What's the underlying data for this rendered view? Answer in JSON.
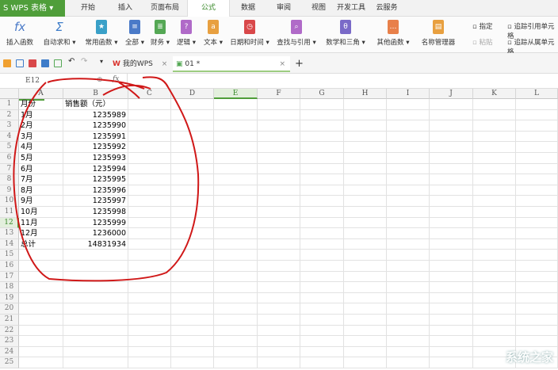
{
  "app": {
    "logo": "WPS 表格",
    "logo_icon": "S",
    "dropdown": "▾"
  },
  "menu_tabs": [
    "开始",
    "插入",
    "页面布局",
    "公式",
    "数据",
    "审阅",
    "视图",
    "开发工具",
    "云服务"
  ],
  "active_tab": "公式",
  "ribbon": {
    "buttons": [
      {
        "label": "插入函数",
        "icon": "fx",
        "color": "#4a7ac8"
      },
      {
        "label": "自动求和 ▾",
        "icon": "Σ",
        "color": "#3d7cc9"
      },
      {
        "label": "常用函数 ▾",
        "icon": "★",
        "color": "#3aa0c8"
      },
      {
        "label": "全部 ▾",
        "icon": "≡",
        "color": "#4a7ac8"
      },
      {
        "label": "财务 ▾",
        "icon": "≣",
        "color": "#55a855"
      },
      {
        "label": "逻辑 ▾",
        "icon": "?",
        "color": "#b06ac8"
      },
      {
        "label": "文本 ▾",
        "icon": "a",
        "color": "#e8a040"
      },
      {
        "label": "日期和时间 ▾",
        "icon": "◷",
        "color": "#d9484a"
      },
      {
        "label": "查找与引用 ▾",
        "icon": "⌕",
        "color": "#b06ac8"
      },
      {
        "label": "数学和三角 ▾",
        "icon": "θ",
        "color": "#7a6ac8"
      },
      {
        "label": "其他函数 ▾",
        "icon": "…",
        "color": "#e8804a"
      },
      {
        "label": "名称管理器",
        "icon": "▤",
        "color": "#e8a040"
      }
    ],
    "small": [
      "指定",
      "粘贴",
      "追踪引用单元格",
      "追踪从属单元格"
    ]
  },
  "quickbar": {
    "home_tab": "我的WPS",
    "doc_tab": "01 *",
    "close": "×",
    "add": "+"
  },
  "formula_bar": {
    "name_box": "E12",
    "fx": "fx",
    "zoom_icon": "⊕"
  },
  "columns": [
    "A",
    "B",
    "C",
    "D",
    "E",
    "F",
    "G",
    "H",
    "I",
    "J",
    "K",
    "L"
  ],
  "selected_column": "E",
  "selected_row": 12,
  "row_count": 25,
  "table": [
    [
      "月份",
      "销售额（元）"
    ],
    [
      "1月",
      "1235989"
    ],
    [
      "2月",
      "1235990"
    ],
    [
      "3月",
      "1235991"
    ],
    [
      "4月",
      "1235992"
    ],
    [
      "5月",
      "1235993"
    ],
    [
      "6月",
      "1235994"
    ],
    [
      "7月",
      "1235995"
    ],
    [
      "8月",
      "1235996"
    ],
    [
      "9月",
      "1235997"
    ],
    [
      "10月",
      "1235998"
    ],
    [
      "11月",
      "1235999"
    ],
    [
      "12月",
      "1236000"
    ],
    [
      "总计",
      "14831934"
    ]
  ],
  "annotation_color": "#d01818",
  "watermark": "系统之家"
}
